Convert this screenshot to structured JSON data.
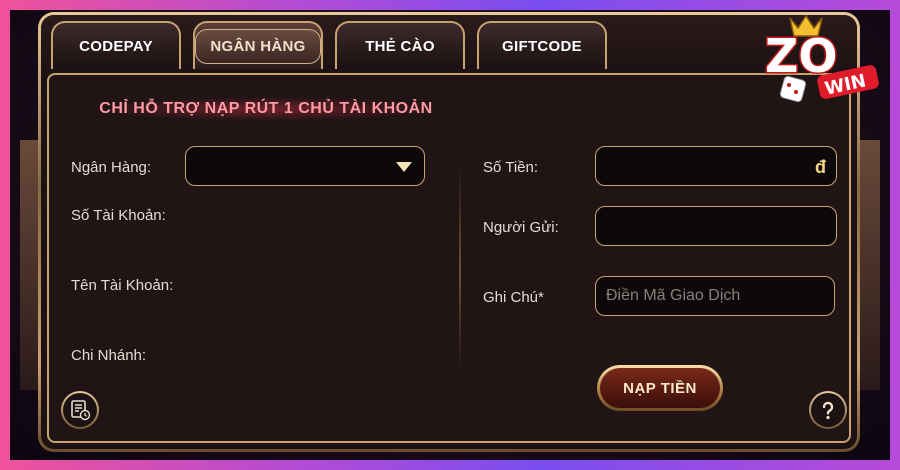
{
  "tabs": [
    {
      "label": "CODEPAY",
      "active": false
    },
    {
      "label": "NGÂN HÀNG",
      "active": true
    },
    {
      "label": "THẺ CÀO",
      "active": false
    },
    {
      "label": "GIFTCODE",
      "active": false
    }
  ],
  "notice": "CHỈ HỖ TRỢ NẠP RÚT 1 CHỦ TÀI KHOẢN",
  "form_left": {
    "bank_label": "Ngân Hàng:",
    "bank_value": "",
    "account_number_label": "Số Tài Khoản:",
    "account_name_label": "Tên Tài Khoản:",
    "branch_label": "Chi Nhánh:"
  },
  "form_right": {
    "amount_label": "Số Tiền:",
    "amount_currency": "đ",
    "sender_label": "Người Gửi:",
    "note_label": "Ghi Chú*",
    "note_placeholder": "Điền Mã Giao Dịch"
  },
  "submit_label": "NẠP TIỀN",
  "logo_text": "ZO WIN",
  "icons": {
    "history": "history-icon",
    "help": "help-icon",
    "dropdown": "chevron-down-icon"
  },
  "colors": {
    "accent_gold": "#c9a36f",
    "notice_red": "#ff9aa4",
    "panel_bg": "#1d1213"
  }
}
